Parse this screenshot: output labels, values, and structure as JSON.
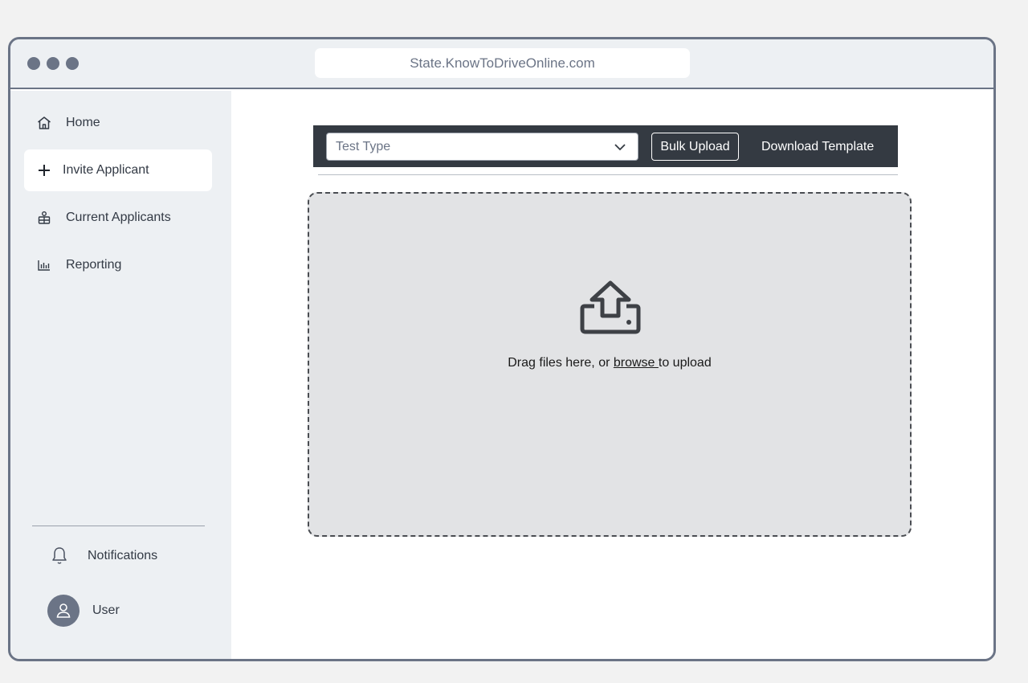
{
  "browser": {
    "url": "State.KnowToDriveOnline.com"
  },
  "sidebar": {
    "items": [
      {
        "label": "Home",
        "icon": "home-icon"
      },
      {
        "label": "Invite Applicant",
        "icon": "plus-icon",
        "active": true
      },
      {
        "label": "Current Applicants",
        "icon": "applicants-icon"
      },
      {
        "label": "Reporting",
        "icon": "bar-chart-icon"
      }
    ],
    "notifications_label": "Notifications",
    "user_label": "User"
  },
  "toolbar": {
    "select_placeholder": "Test Type",
    "bulk_upload_label": "Bulk Upload",
    "download_template_label": "Download Template"
  },
  "dropzone": {
    "text_before": "Drag files here, or ",
    "browse_label": "browse ",
    "text_after": "to upload"
  },
  "colors": {
    "frame": "#6b7486",
    "sidebar_bg": "#edf0f3",
    "toolbar_bg": "#343a42",
    "dropzone_bg": "#e2e3e5"
  }
}
